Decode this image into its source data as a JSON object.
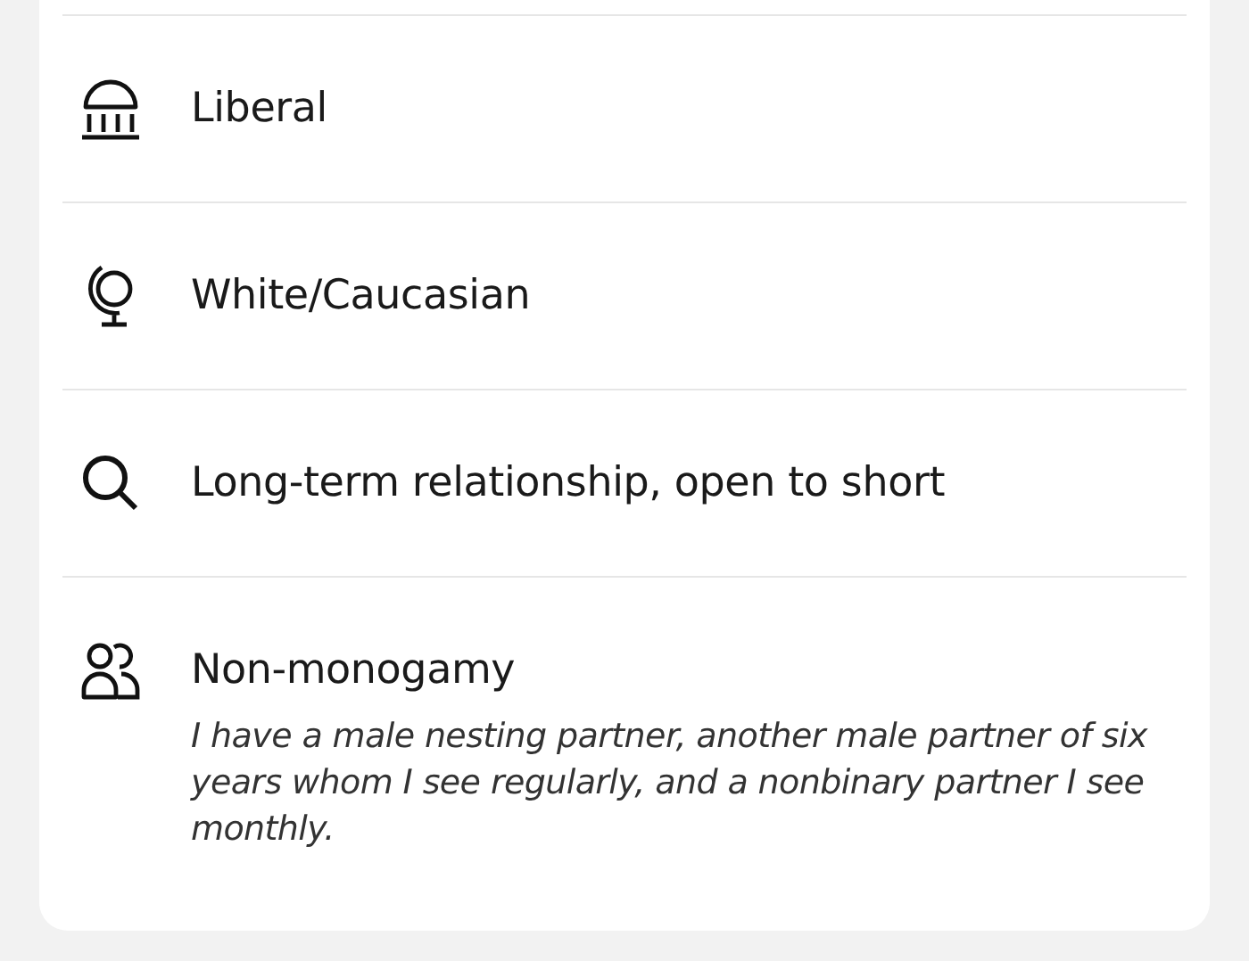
{
  "rows": [
    {
      "kind": "politics",
      "label": "Liberal"
    },
    {
      "kind": "ethnicity",
      "label": "White/Caucasian"
    },
    {
      "kind": "looking_for",
      "label": "Long-term relationship, open to short"
    },
    {
      "kind": "relationship_type",
      "label": "Non-monogamy",
      "description": "I have a male nesting partner, another male partner of six years whom I see regularly, and a nonbinary partner I see monthly."
    }
  ]
}
